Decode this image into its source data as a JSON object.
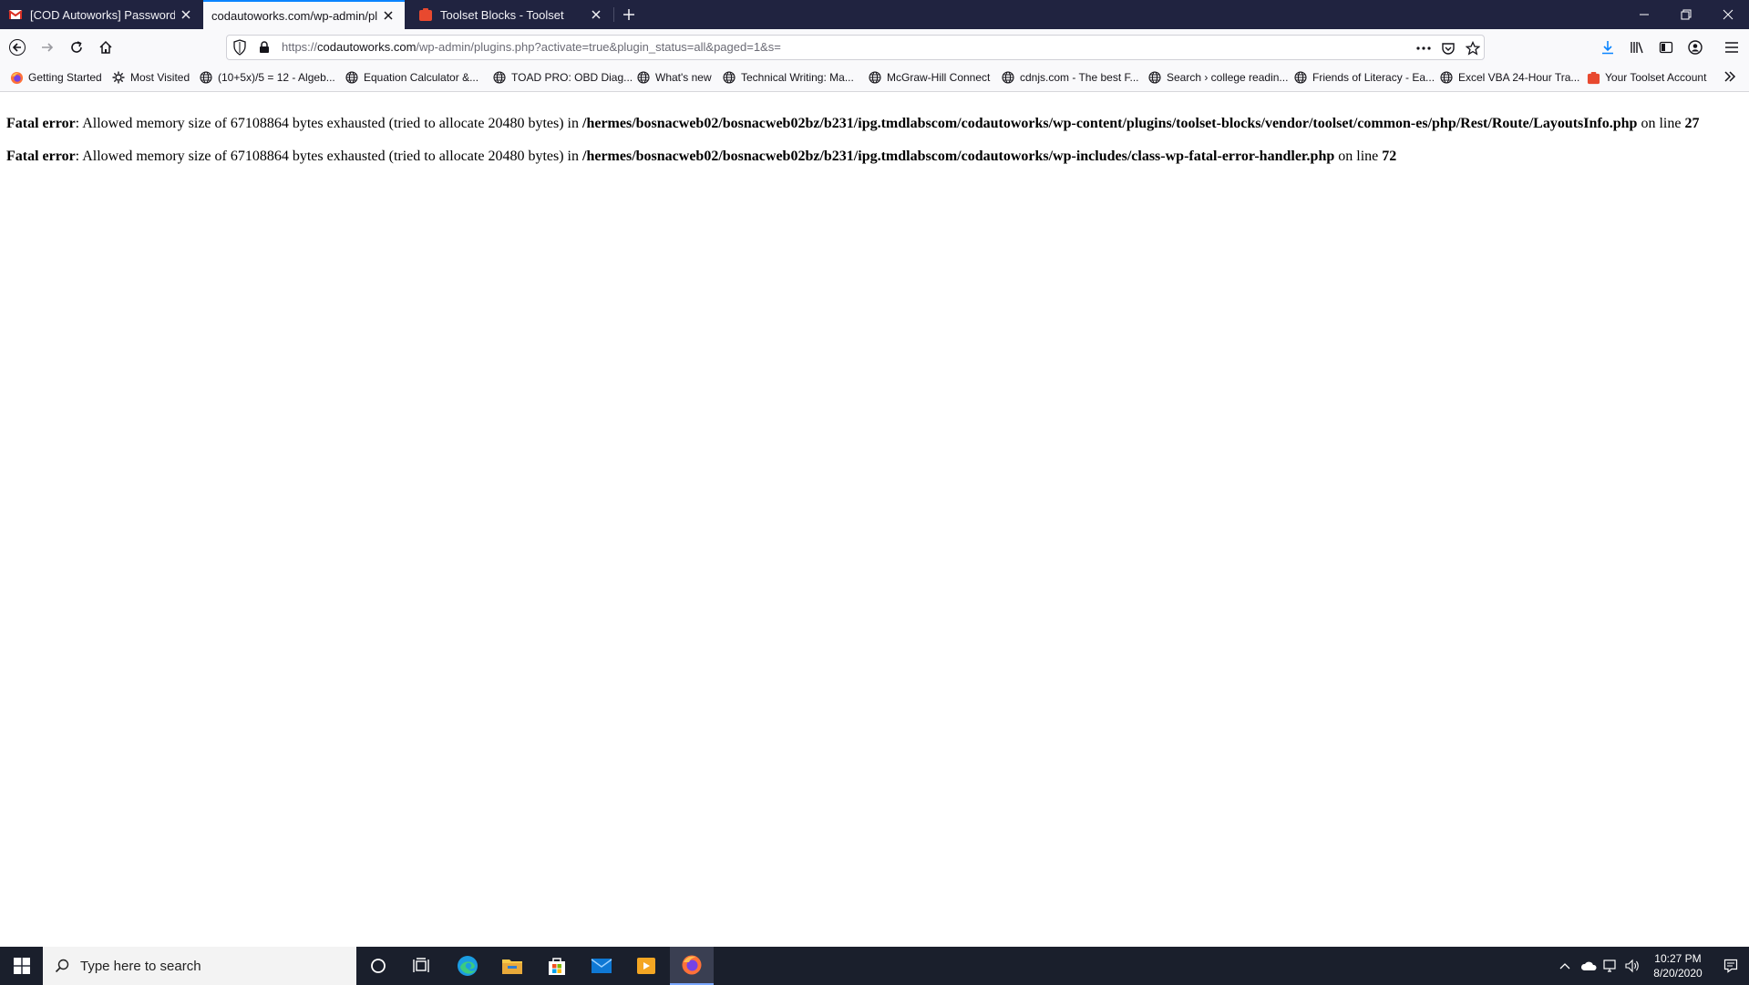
{
  "browser": {
    "tabs": [
      {
        "title": "[COD Autoworks] Password Re",
        "favicon": "gmail-icon",
        "active": false
      },
      {
        "title": "codautoworks.com/wp-admin/plu",
        "favicon": "none",
        "active": true
      },
      {
        "title": "Toolset Blocks - Toolset",
        "favicon": "toolset-icon",
        "active": false
      }
    ],
    "url": {
      "prefix": "https://",
      "host": "codautoworks.com",
      "path": "/wp-admin/plugins.php?activate=true&plugin_status=all&paged=1&s="
    },
    "bookmarks": [
      {
        "label": "Getting Started",
        "icon": "firefox-icon"
      },
      {
        "label": "Most Visited",
        "icon": "gear-icon"
      },
      {
        "label": "(10+5x)/5 = 12 - Algeb...",
        "icon": "globe-icon"
      },
      {
        "label": "Equation Calculator &...",
        "icon": "globe-icon"
      },
      {
        "label": "TOAD PRO: OBD Diag...",
        "icon": "globe-icon"
      },
      {
        "label": "What's new",
        "icon": "globe-icon"
      },
      {
        "label": "Technical Writing: Ma...",
        "icon": "globe-icon"
      },
      {
        "label": "McGraw-Hill Connect",
        "icon": "globe-icon"
      },
      {
        "label": "cdnjs.com - The best F...",
        "icon": "globe-icon"
      },
      {
        "label": "Search › college readin...",
        "icon": "globe-icon"
      },
      {
        "label": "Friends of Literacy - Ea...",
        "icon": "globe-icon"
      },
      {
        "label": "Excel VBA 24-Hour Tra...",
        "icon": "globe-icon"
      },
      {
        "label": "Your Toolset Account",
        "icon": "toolset-icon"
      }
    ]
  },
  "page": {
    "errors": [
      {
        "label": "Fatal error",
        "message": ": Allowed memory size of 67108864 bytes exhausted (tried to allocate 20480 bytes) in ",
        "file": "/hermes/bosnacweb02/bosnacweb02bz/b231/ipg.tmdlabscom/codautoworks/wp-content/plugins/toolset-blocks/vendor/toolset/common-es/php/Rest/Route/LayoutsInfo.php",
        "line_prefix": " on line ",
        "line": "27"
      },
      {
        "label": "Fatal error",
        "message": ": Allowed memory size of 67108864 bytes exhausted (tried to allocate 20480 bytes) in ",
        "file": "/hermes/bosnacweb02/bosnacweb02bz/b231/ipg.tmdlabscom/codautoworks/wp-includes/class-wp-fatal-error-handler.php",
        "line_prefix": " on line ",
        "line": "72"
      }
    ]
  },
  "taskbar": {
    "search_placeholder": "Type here to search",
    "time": "10:27 PM",
    "date": "8/20/2020"
  },
  "colors": {
    "tabstrip": "#202340",
    "accent": "#0a84ff",
    "taskbar": "#1a1f2c"
  }
}
